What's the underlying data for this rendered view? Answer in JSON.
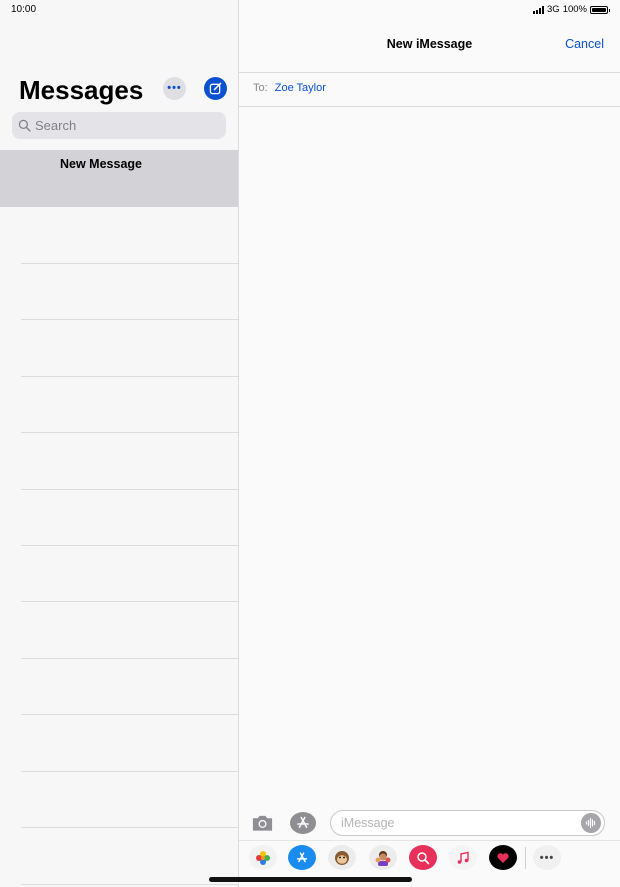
{
  "status_bar": {
    "time": "10:00",
    "network": "3G",
    "battery": "100%"
  },
  "sidebar": {
    "title": "Messages",
    "more_symbol": "•••",
    "search_placeholder": "Search",
    "selected_item": "New Message",
    "icons": {
      "more": "ellipsis-icon",
      "compose": "compose-icon",
      "search": "search-icon"
    }
  },
  "conversation": {
    "title": "New iMessage",
    "cancel_label": "Cancel",
    "to_label": "To:",
    "recipient": "Zoe Taylor",
    "input_placeholder": "iMessage"
  },
  "app_tray": {
    "apps": [
      "photos-icon",
      "app-store-icon",
      "animoji-icon",
      "memoji-icon",
      "search-images-icon",
      "music-icon",
      "digital-touch-icon",
      "more-apps-icon"
    ]
  },
  "colors": {
    "accent": "#0a50cf",
    "background": "#f7f7f7",
    "selected_row": "#d2d2d7"
  }
}
